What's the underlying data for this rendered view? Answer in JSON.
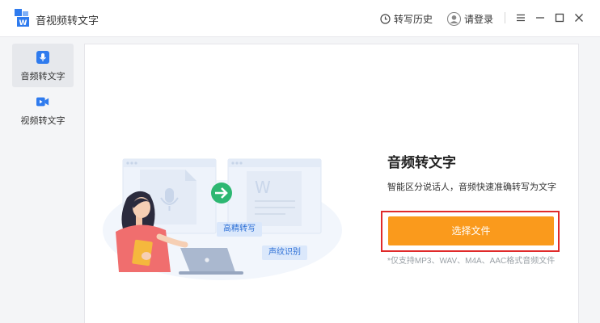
{
  "app": {
    "title": "音视频转文字"
  },
  "header": {
    "history_label": "转写历史",
    "login_label": "请登录"
  },
  "sidebar": {
    "items": [
      {
        "label": "音频转文字",
        "icon": "microphone-icon",
        "active": true
      },
      {
        "label": "视频转文字",
        "icon": "video-camera-icon",
        "active": false
      }
    ]
  },
  "main": {
    "badges": [
      "高精转写",
      "声纹识别"
    ],
    "title": "音频转文字",
    "description": "智能区分说话人，音频快速准确转写为文字",
    "button_label": "选择文件",
    "support_note": "*仅支持MP3、WAV、M4A、AAC格式音频文件"
  },
  "colors": {
    "accent": "#fa9a1c",
    "brand_blue": "#2f7bee",
    "highlight_frame": "#e02a2a",
    "badge_bg": "#dbe8fb"
  }
}
